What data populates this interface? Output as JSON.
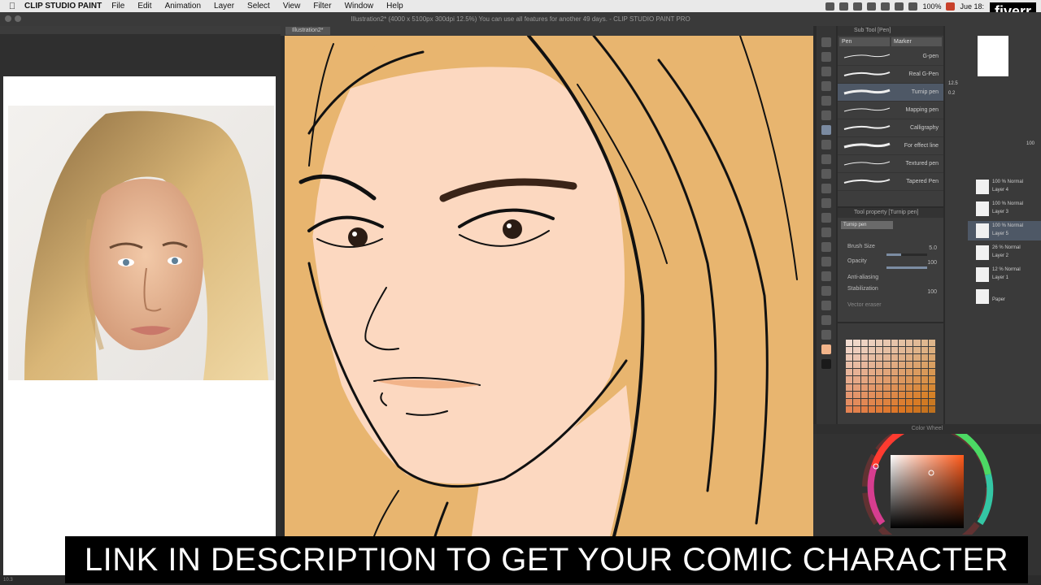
{
  "menubar": {
    "app_name": "CLIP STUDIO PAINT",
    "items": [
      "File",
      "Edit",
      "Animation",
      "Layer",
      "Select",
      "View",
      "Filter",
      "Window",
      "Help"
    ],
    "battery": "100%",
    "date": "Jue 18:",
    "brand": "fiverr"
  },
  "window": {
    "title": "Illustration2* (4000 x 5100px 300dpi 12.5%)  You can use all features for another 49 days. - CLIP STUDIO PAINT PRO",
    "canvas_tab": "Illustration2*"
  },
  "subtool": {
    "header": "Sub Tool [Pen]",
    "tabs": [
      "Pen",
      "Marker"
    ],
    "brushes": [
      {
        "name": "G-pen",
        "selected": false
      },
      {
        "name": "Real G-Pen",
        "selected": false
      },
      {
        "name": "Turnip pen",
        "selected": true
      },
      {
        "name": "Mapping pen",
        "selected": false
      },
      {
        "name": "Calligraphy",
        "selected": false
      },
      {
        "name": "For effect line",
        "selected": false
      },
      {
        "name": "Textured pen",
        "selected": false
      },
      {
        "name": "Tapered Pen",
        "selected": false
      }
    ]
  },
  "toolproperty": {
    "header": "Tool property [Turnip pen]",
    "current": "Turnip pen",
    "brush_size_label": "Brush Size",
    "brush_size": "5.0",
    "brush_size_fraction": 0.35,
    "opacity_label": "Opacity",
    "opacity": "100",
    "anti_alias_label": "Anti-aliasing",
    "stabilization_label": "Stabilization",
    "stabilization": "100",
    "vector_label": "Vector eraser"
  },
  "layers": {
    "zoom": "12.5",
    "angle": "0.2",
    "opacity": "100",
    "items": [
      {
        "mode": "100 % Normal",
        "name": "Layer 4",
        "selected": false
      },
      {
        "mode": "100 % Normal",
        "name": "Layer 3",
        "selected": false
      },
      {
        "mode": "100 % Normal",
        "name": "Layer 5",
        "selected": true
      },
      {
        "mode": "26 % Normal",
        "name": "Layer 2",
        "selected": false
      },
      {
        "mode": "12 % Normal",
        "name": "Layer 1",
        "selected": false
      },
      {
        "mode": "",
        "name": "Paper",
        "selected": false
      }
    ]
  },
  "colorwheel": {
    "header": "Color Wheel",
    "main_color": "#b4532d",
    "hue_square": "#ff5a1a"
  },
  "colors": {
    "skin": "#fcd8c0",
    "hair": "#e8b56f",
    "line": "#111111"
  },
  "caption": "LINK IN DESCRIPTION TO GET YOUR COMIC CHARACTER",
  "status": "10.3"
}
